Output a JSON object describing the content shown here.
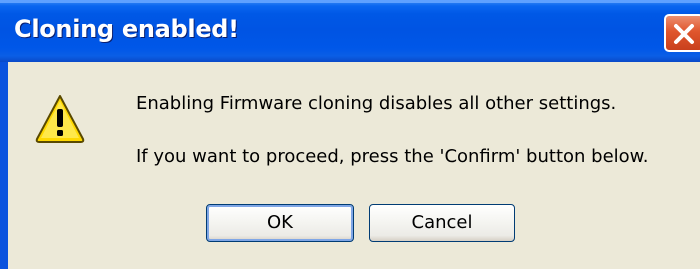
{
  "dialog": {
    "title": "Cloning enabled!",
    "message_line1": "Enabling Firmware cloning disables all other settings.",
    "message_line2": "If you want to proceed, press the 'Confirm' button below.",
    "icon": "warning-icon"
  },
  "buttons": {
    "ok_label": "OK",
    "cancel_label": "Cancel"
  },
  "titlebar": {
    "close_icon": "close-icon"
  },
  "colors": {
    "titlebar_blue": "#0054e3",
    "close_red": "#e0562d",
    "client_bg": "#ece9d8",
    "warning_yellow": "#ffd800"
  }
}
